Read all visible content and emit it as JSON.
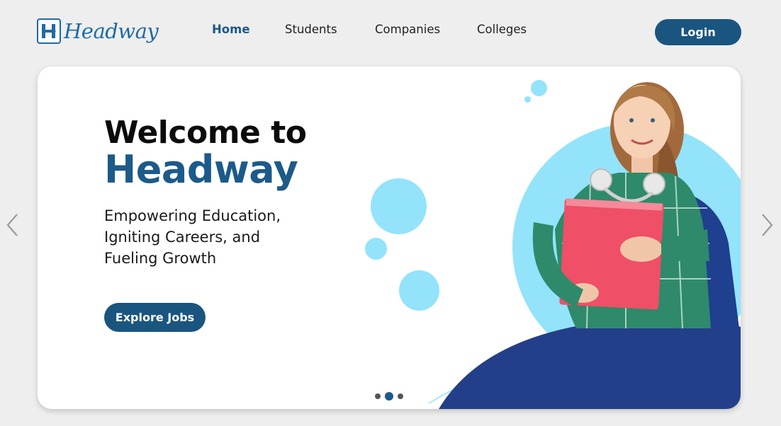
{
  "brand": {
    "name": "Headway",
    "logo_icon": "h-monogram-icon"
  },
  "nav": {
    "items": [
      {
        "label": "Home",
        "active": true
      },
      {
        "label": "Students",
        "active": false
      },
      {
        "label": "Companies",
        "active": false
      },
      {
        "label": "Colleges",
        "active": false
      }
    ],
    "login_label": "Login"
  },
  "hero": {
    "title_line1": "Welcome to",
    "title_line2": "Headway",
    "subtitle": "Empowering Education, Igniting Careers, and Fueling Growth",
    "cta_label": "Explore Jobs",
    "image": "student-holding-red-folder-photo"
  },
  "carousel": {
    "slide_count": 3,
    "active_index": 1,
    "prev_icon": "chevron-left-icon",
    "next_icon": "chevron-right-icon"
  },
  "colors": {
    "primary": "#1a5580",
    "accent_light": "#93e3fb",
    "wave_navy": "#233f8a",
    "page_bg": "#eeeeee"
  }
}
